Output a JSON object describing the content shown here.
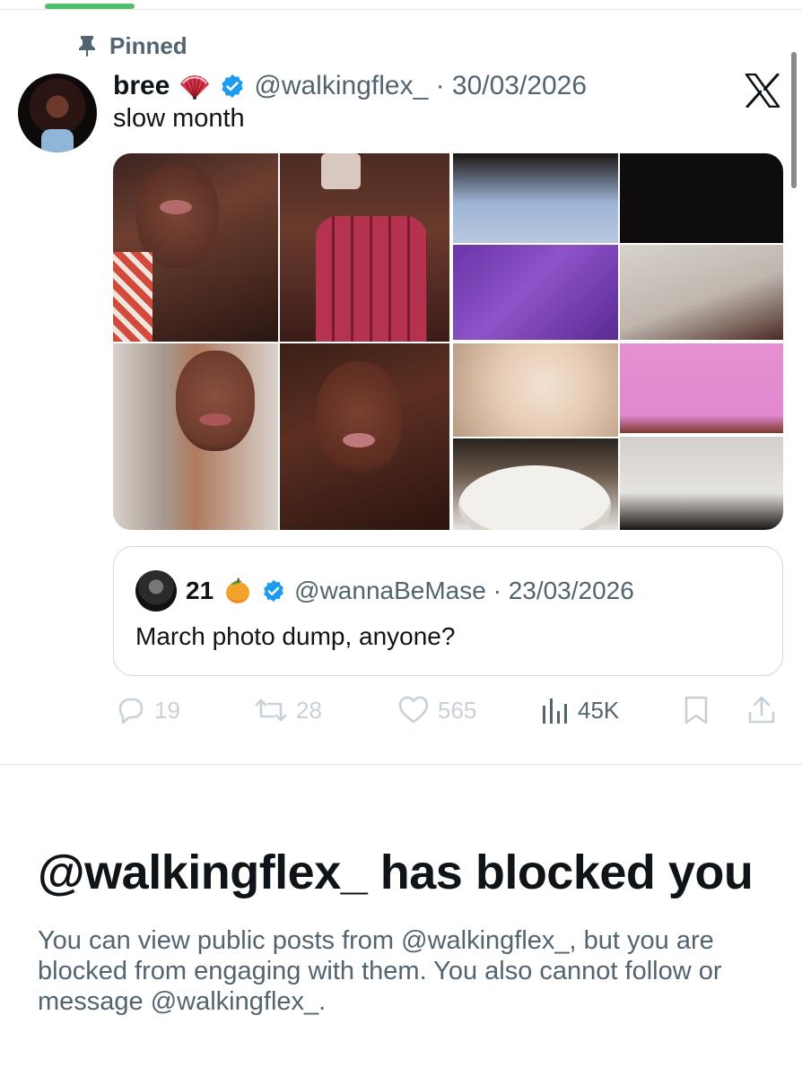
{
  "pinned": {
    "label": "Pinned",
    "icon": "pin-icon"
  },
  "tweet": {
    "display_name": "bree",
    "name_emoji": "fan-icon",
    "verified": true,
    "handle_date": "@walkingflex_ · 30/03/2026",
    "text": "slow month",
    "source_icon": "x-logo-icon"
  },
  "quote": {
    "display_name": "21",
    "name_emoji": "mango-icon",
    "verified": true,
    "handle_date": "@wannaBeMase · 23/03/2026",
    "text": "March photo dump, anyone?"
  },
  "actions": {
    "replies": "19",
    "reposts": "28",
    "likes": "565",
    "views": "45K"
  },
  "blocked": {
    "title": "@walkingflex_ has blocked you",
    "body": "You can view public posts from @walkingflex_, but you are blocked from engaging with them. You also cannot follow or message @walkingflex_."
  },
  "colors": {
    "text_primary": "#0f1419",
    "text_secondary": "#536471",
    "verified_blue": "#1d9bf0",
    "disabled_action": "#c9d1d8",
    "tab_indicator": "#4fbf6f"
  }
}
